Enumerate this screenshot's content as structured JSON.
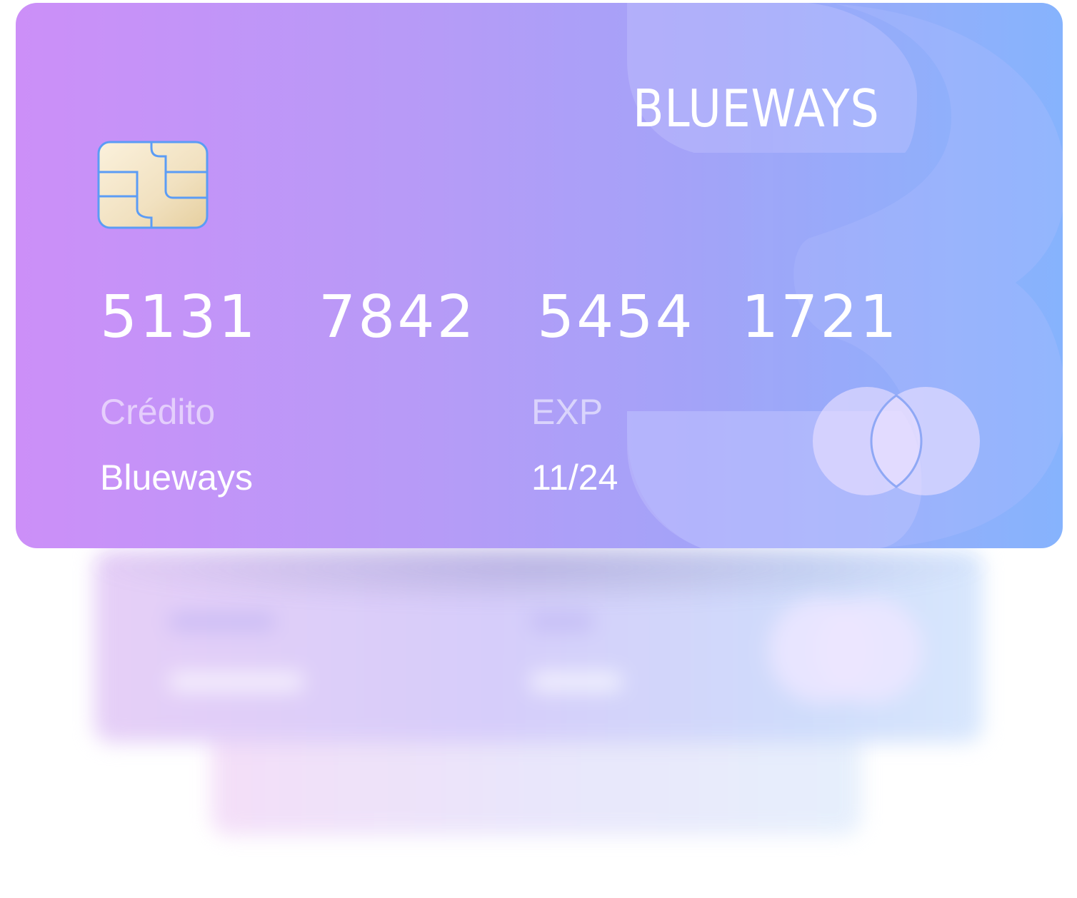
{
  "card": {
    "brand": "BLUEWAYS",
    "number_groups": [
      "5131",
      "7842",
      "5454",
      "1721"
    ],
    "type_label": "Crédito",
    "holder_name": "Blueways",
    "exp_label": "EXP",
    "exp_value": "11/24",
    "chip_icon": "emv-chip-icon",
    "network_icon": "card-network-circles-icon",
    "watermark_icon": "letter-b-watermark-icon"
  },
  "colors": {
    "gradient_start": "#cc8ff8",
    "gradient_end": "#86b3fd",
    "chip_fill": "#f3e3c2",
    "chip_stroke": "#5b9cf5",
    "text": "#ffffff"
  }
}
